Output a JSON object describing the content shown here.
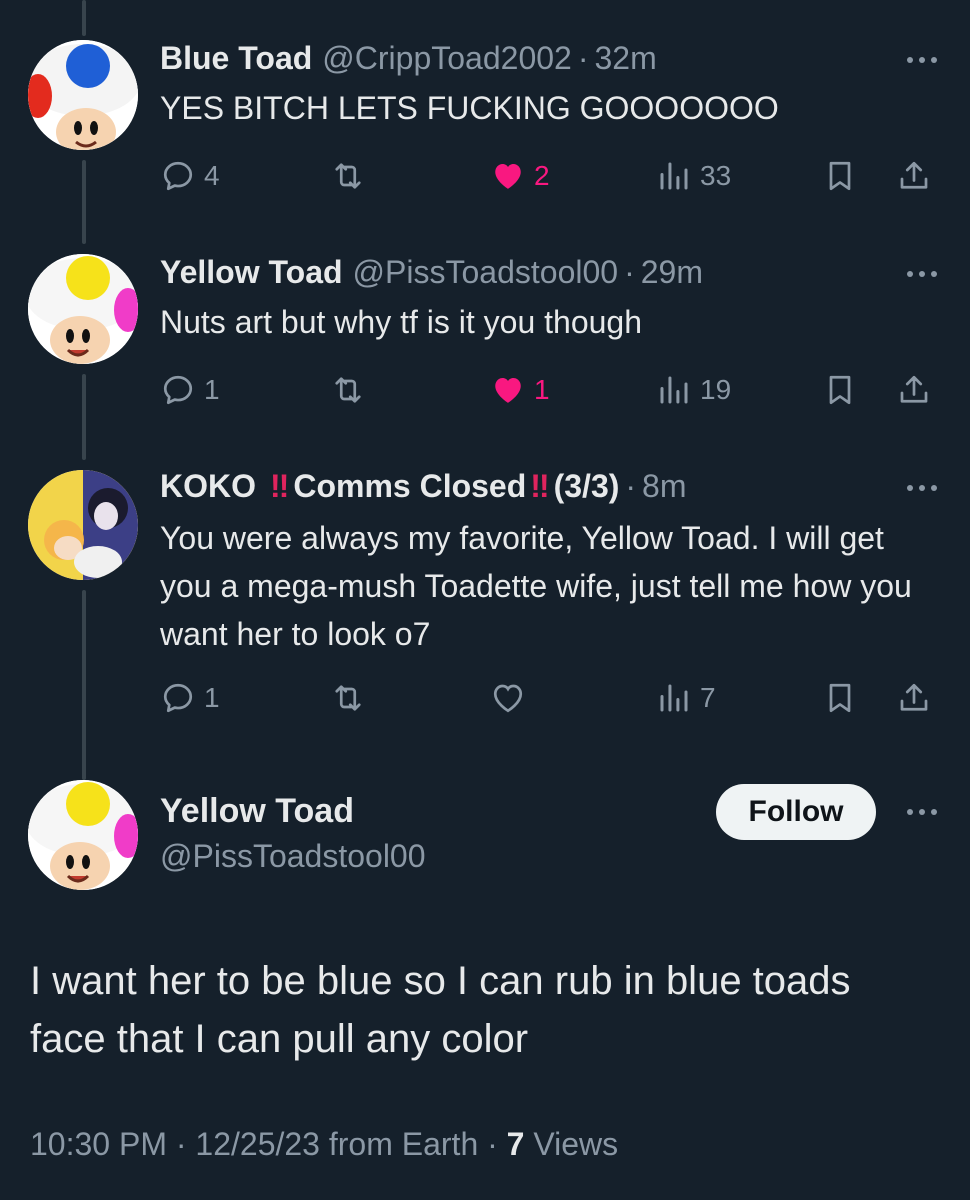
{
  "replies": [
    {
      "name": "Blue Toad",
      "handle": "@CrippToad2002",
      "separator": "·",
      "time": "32m",
      "text": "YES BITCH LETS FUCKING GOOOOOOO",
      "replies_count": "4",
      "likes_count": "2",
      "views_count": "33",
      "liked": true
    },
    {
      "name": "Yellow Toad",
      "handle": "@PissToadstool00",
      "separator": "·",
      "time": "29m",
      "text": "Nuts art but why tf is it you though",
      "replies_count": "1",
      "likes_count": "1",
      "views_count": "19",
      "liked": true
    },
    {
      "name_part1": "KOKO",
      "bang1": "‼",
      "name_part2": "Comms Closed",
      "bang2": "‼",
      "name_part3": "(3/3)",
      "separator": "·",
      "time": "8m",
      "text": "You were always my favorite, Yellow Toad. I will get you a mega-mush Toadette wife, just tell me how you want her to look o7",
      "replies_count": "1",
      "views_count": "7",
      "liked": false
    }
  ],
  "main_post": {
    "name": "Yellow Toad",
    "handle": "@PissToadstool00",
    "follow_label": "Follow",
    "text": "I want her to be blue so I can rub in blue toads face that I can pull any color",
    "time": "10:30 PM",
    "date": "12/25/23",
    "source": "from Earth",
    "separator": "·",
    "views_count": "7",
    "views_label": "Views"
  },
  "colors": {
    "background": "#15202b",
    "text": "#e7e9ea",
    "muted": "#8b98a5",
    "like": "#f91880",
    "thread_line": "#38444d"
  },
  "icons": [
    "reply-icon",
    "retweet-icon",
    "heart-icon",
    "views-icon",
    "bookmark-icon",
    "share-icon",
    "more-icon"
  ]
}
